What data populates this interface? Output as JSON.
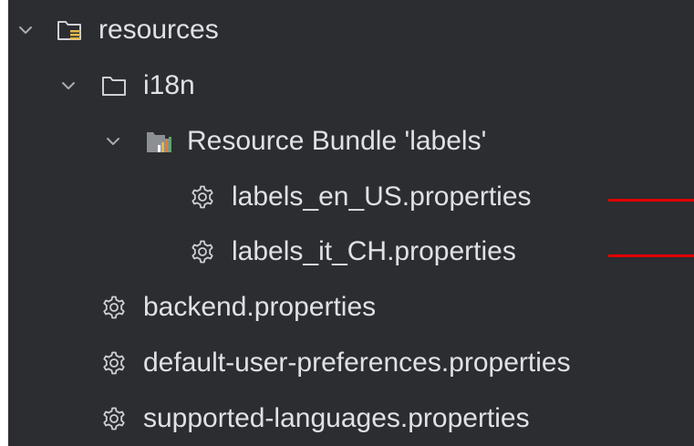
{
  "tree": {
    "items": [
      {
        "label": "resources",
        "icon": "resources-folder-icon",
        "expanded": true
      },
      {
        "label": "i18n",
        "icon": "folder-icon",
        "expanded": true
      },
      {
        "label": "Resource Bundle 'labels'",
        "icon": "resource-bundle-icon",
        "expanded": true
      },
      {
        "label": "labels_en_US.properties",
        "icon": "gear-icon"
      },
      {
        "label": "labels_it_CH.properties",
        "icon": "gear-icon"
      },
      {
        "label": "backend.properties",
        "icon": "gear-icon"
      },
      {
        "label": "default-user-preferences.properties",
        "icon": "gear-icon"
      },
      {
        "label": "supported-languages.properties",
        "icon": "gear-icon"
      }
    ]
  },
  "colors": {
    "panel_background": "#2b2d30",
    "text": "#dfe1e5",
    "annotation": "#e00000"
  }
}
